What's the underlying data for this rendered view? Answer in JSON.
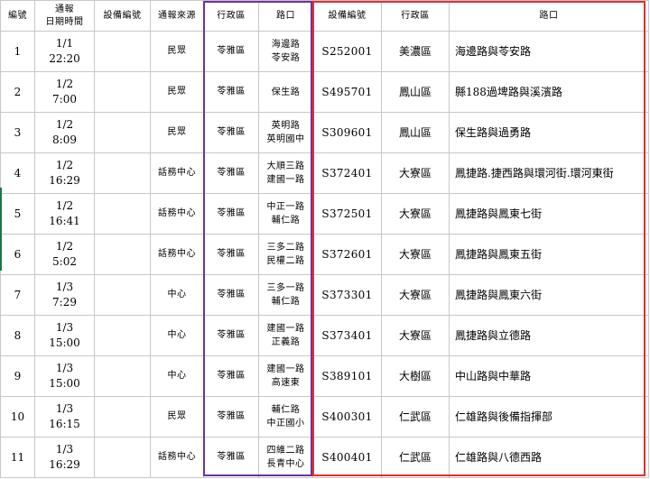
{
  "headers": {
    "no": "編號",
    "datetime_line1": "通報",
    "datetime_line2": "日期時間",
    "device_empty": "設備編號",
    "source": "通報來源",
    "district": "行政區",
    "road": "路口",
    "device": "設備編號",
    "district2": "行政區",
    "road2": "路口"
  },
  "rows": [
    {
      "no": "1",
      "date": "1/1",
      "time": "22:20",
      "source": "民眾",
      "district": "苓雅區",
      "road_a": "海邊路",
      "road_b": "苓安路",
      "device": "S252001",
      "district2": "美濃區",
      "road2": "海邊路與苓安路"
    },
    {
      "no": "2",
      "date": "1/2",
      "time": "7:00",
      "source": "民眾",
      "district": "苓雅區",
      "road_a": "保生路",
      "road_b": "",
      "device": "S495701",
      "district2": "鳳山區",
      "road2": "縣188過埤路與溪濱路"
    },
    {
      "no": "3",
      "date": "1/2",
      "time": "8:09",
      "source": "民眾",
      "district": "苓雅區",
      "road_a": "英明路",
      "road_b": "英明國中",
      "device": "S309601",
      "district2": "鳳山區",
      "road2": "保生路與過勇路"
    },
    {
      "no": "4",
      "date": "1/2",
      "time": "16:29",
      "source": "話務中心",
      "district": "苓雅區",
      "road_a": "大順三路",
      "road_b": "建國一路",
      "device": "S372401",
      "district2": "大寮區",
      "road2": "鳳捷路.捷西路與環河街.環河東街"
    },
    {
      "no": "5",
      "date": "1/2",
      "time": "16:41",
      "source": "話務中心",
      "district": "苓雅區",
      "road_a": "中正一路",
      "road_b": "輔仁路",
      "device": "S372501",
      "district2": "大寮區",
      "road2": "鳳捷路與鳳東七街"
    },
    {
      "no": "6",
      "date": "1/2",
      "time": "5:02",
      "source": "話務中心",
      "district": "苓雅區",
      "road_a": "三多二路",
      "road_b": "民權二路",
      "device": "S372601",
      "district2": "大寮區",
      "road2": "鳳捷路與鳳東五街"
    },
    {
      "no": "7",
      "date": "1/3",
      "time": "7:29",
      "source": "中心",
      "district": "苓雅區",
      "road_a": "三多一路",
      "road_b": "輔仁路",
      "device": "S373301",
      "district2": "大寮區",
      "road2": "鳳捷路與鳳東六街"
    },
    {
      "no": "8",
      "date": "1/3",
      "time": "15:00",
      "source": "中心",
      "district": "苓雅區",
      "road_a": "建國一路",
      "road_b": "正義路",
      "device": "S373401",
      "district2": "大寮區",
      "road2": "鳳捷路與立德路"
    },
    {
      "no": "9",
      "date": "1/3",
      "time": "15:00",
      "source": "中心",
      "district": "苓雅區",
      "road_a": "建國一路",
      "road_b": "高速東",
      "device": "S389101",
      "district2": "大樹區",
      "road2": "中山路與中華路"
    },
    {
      "no": "10",
      "date": "1/3",
      "time": "16:15",
      "source": "民眾",
      "district": "苓雅區",
      "road_a": "輔仁路",
      "road_b": "中正國小",
      "device": "S400301",
      "district2": "仁武區",
      "road2": "仁雄路與後備指揮部"
    },
    {
      "no": "11",
      "date": "1/3",
      "time": "16:29",
      "source": "話務中心",
      "district": "苓雅區",
      "road_a": "四維二路",
      "road_b": "長青中心",
      "device": "S400401",
      "district2": "仁武區",
      "road2": "仁雄路與八德西路"
    }
  ],
  "colors": {
    "purple_box": "#7030a0",
    "red_box": "#e03030",
    "grid": "#c8c8c8",
    "selection_marker": "#217346"
  }
}
